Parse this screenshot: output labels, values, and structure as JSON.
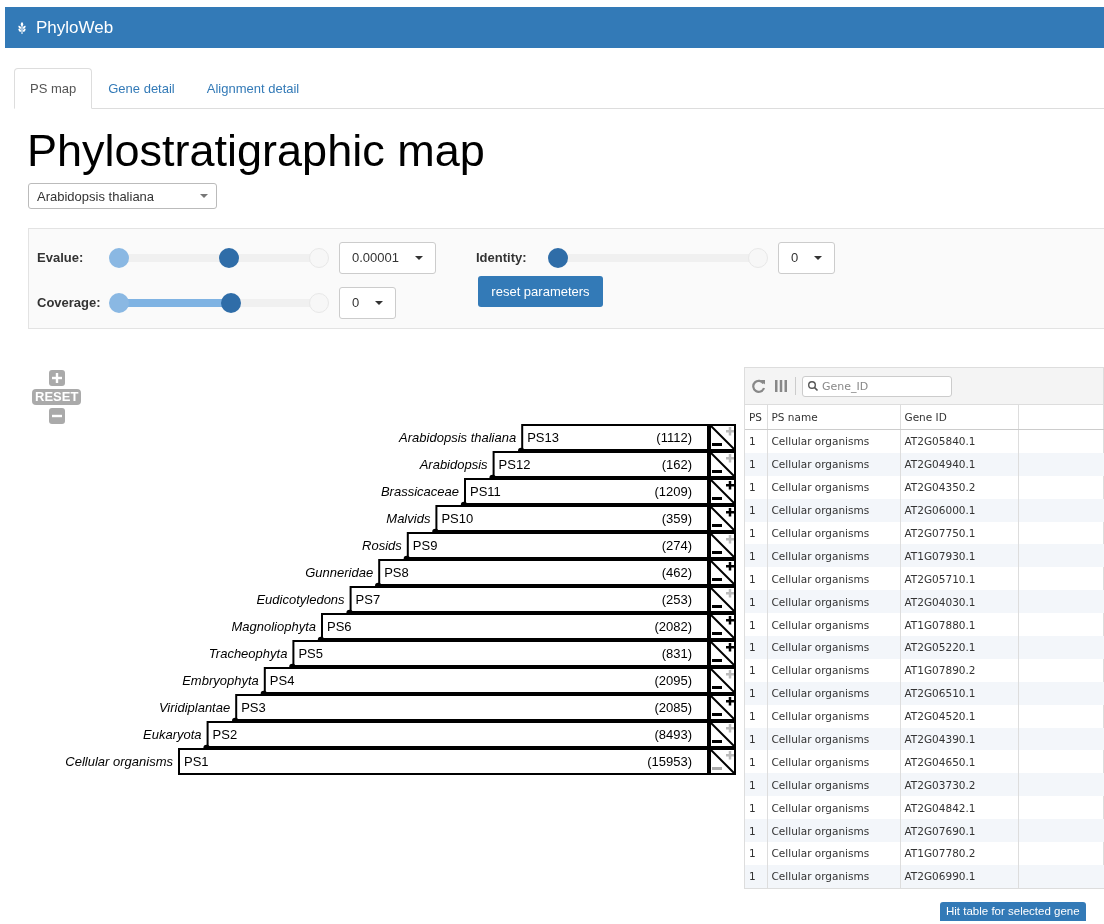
{
  "app": {
    "title": "PhyloWeb"
  },
  "tabs": [
    {
      "label": "PS map",
      "selected": true
    },
    {
      "label": "Gene detail",
      "selected": false
    },
    {
      "label": "Alignment detail",
      "selected": false
    }
  ],
  "heading": "Phylostratigraphic map",
  "species_select": {
    "value": "Arabidopsis thaliana"
  },
  "filters": [
    {
      "label": "Evalue:",
      "kind": "range",
      "level": 0.55,
      "fill_shown": false,
      "dropdown": "0.00001"
    },
    {
      "label": "Coverage:",
      "kind": "range",
      "level": 0.56,
      "fill_shown": true,
      "dropdown": "0"
    },
    {
      "label": "Identity:",
      "kind": "single",
      "level": 0,
      "fill_shown": false,
      "dropdown": "0"
    }
  ],
  "reset_button": "reset parameters",
  "zoom_controls": {
    "reset": "RESET"
  },
  "tree": {
    "rows": [
      {
        "taxon": "Arabidopsis thaliana",
        "ps": "PS13",
        "count": "(1112)",
        "minus_enabled": true,
        "plus_enabled": false
      },
      {
        "taxon": "Arabidopsis",
        "ps": "PS12",
        "count": "(162)",
        "minus_enabled": true,
        "plus_enabled": false
      },
      {
        "taxon": "Brassicaceae",
        "ps": "PS11",
        "count": "(1209)",
        "minus_enabled": true,
        "plus_enabled": true
      },
      {
        "taxon": "Malvids",
        "ps": "PS10",
        "count": "(359)",
        "minus_enabled": true,
        "plus_enabled": true
      },
      {
        "taxon": "Rosids",
        "ps": "PS9",
        "count": "(274)",
        "minus_enabled": true,
        "plus_enabled": false
      },
      {
        "taxon": "Gunneridae",
        "ps": "PS8",
        "count": "(462)",
        "minus_enabled": true,
        "plus_enabled": true
      },
      {
        "taxon": "Eudicotyledons",
        "ps": "PS7",
        "count": "(253)",
        "minus_enabled": true,
        "plus_enabled": false
      },
      {
        "taxon": "Magnoliophyta",
        "ps": "PS6",
        "count": "(2082)",
        "minus_enabled": true,
        "plus_enabled": true
      },
      {
        "taxon": "Tracheophyta",
        "ps": "PS5",
        "count": "(831)",
        "minus_enabled": true,
        "plus_enabled": true
      },
      {
        "taxon": "Embryophyta",
        "ps": "PS4",
        "count": "(2095)",
        "minus_enabled": true,
        "plus_enabled": false
      },
      {
        "taxon": "Viridiplantae",
        "ps": "PS3",
        "count": "(2085)",
        "minus_enabled": true,
        "plus_enabled": true
      },
      {
        "taxon": "Eukaryota",
        "ps": "PS2",
        "count": "(8493)",
        "minus_enabled": true,
        "plus_enabled": false
      },
      {
        "taxon": "Cellular organisms",
        "ps": "PS1",
        "count": "(15953)",
        "minus_enabled": false,
        "plus_enabled": false
      }
    ]
  },
  "gene_table": {
    "search": {
      "placeholder": "Gene_ID"
    },
    "columns": [
      "PS",
      "PS name",
      "Gene ID"
    ],
    "rows": [
      [
        "1",
        "Cellular organisms",
        "AT2G05840.1"
      ],
      [
        "1",
        "Cellular organisms",
        "AT2G04940.1"
      ],
      [
        "1",
        "Cellular organisms",
        "AT2G04350.2"
      ],
      [
        "1",
        "Cellular organisms",
        "AT2G06000.1"
      ],
      [
        "1",
        "Cellular organisms",
        "AT2G07750.1"
      ],
      [
        "1",
        "Cellular organisms",
        "AT1G07930.1"
      ],
      [
        "1",
        "Cellular organisms",
        "AT2G05710.1"
      ],
      [
        "1",
        "Cellular organisms",
        "AT2G04030.1"
      ],
      [
        "1",
        "Cellular organisms",
        "AT1G07880.1"
      ],
      [
        "1",
        "Cellular organisms",
        "AT2G05220.1"
      ],
      [
        "1",
        "Cellular organisms",
        "AT1G07890.2"
      ],
      [
        "1",
        "Cellular organisms",
        "AT2G06510.1"
      ],
      [
        "1",
        "Cellular organisms",
        "AT2G04520.1"
      ],
      [
        "1",
        "Cellular organisms",
        "AT2G04390.1"
      ],
      [
        "1",
        "Cellular organisms",
        "AT2G04650.1"
      ],
      [
        "1",
        "Cellular organisms",
        "AT2G03730.2"
      ],
      [
        "1",
        "Cellular organisms",
        "AT2G04842.1"
      ],
      [
        "1",
        "Cellular organisms",
        "AT2G07690.1"
      ],
      [
        "1",
        "Cellular organisms",
        "AT1G07780.2"
      ],
      [
        "1",
        "Cellular organisms",
        "AT2G06990.1"
      ]
    ],
    "hit_button": "Hit table for selected gene"
  }
}
